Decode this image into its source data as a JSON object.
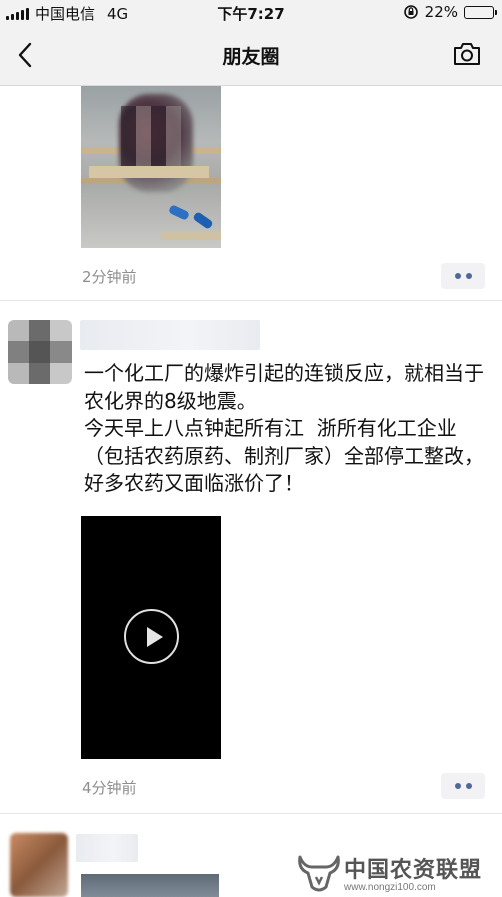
{
  "status_bar": {
    "carrier": "中国电信",
    "network": "4G",
    "time": "下午7:27",
    "battery_text": "22%",
    "battery_level": 0.22
  },
  "nav": {
    "title": "朋友圈",
    "back_icon": "chevron-left-icon",
    "camera_icon": "camera-icon"
  },
  "posts": [
    {
      "timestamp": "2分钟前",
      "media": "photo"
    },
    {
      "text": "一个化工厂的爆炸引起的连锁反应，就相当于农化界的8级地震。\n今天早上八点钟起所有江  浙所有化工企业（包括农药原药、制剂厂家）全部停工整改，好多农药又面临涨价了！",
      "timestamp": "4分钟前",
      "media": "video"
    }
  ],
  "watermark": {
    "title": "中国农资联盟",
    "url": "www.nongzi100.com"
  },
  "colors": {
    "bar_bg": "#f2f2f2",
    "link_dots": "#4f6899",
    "timestamp": "#8e8e8e"
  }
}
